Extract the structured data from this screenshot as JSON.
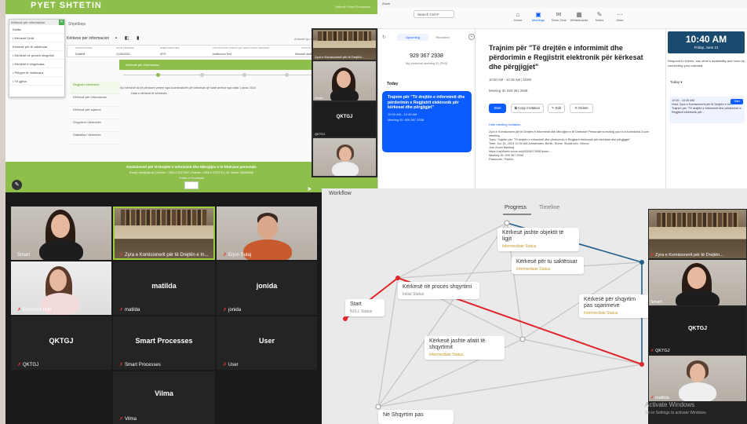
{
  "web_app": {
    "title": "PYET SHTETIN",
    "top_right": "Ndihmë   Smart Processes",
    "menu_header": "Kërkesë për informacion",
    "menu_items": [
      "Drafte",
      "• Kërkesë Draft",
      "Kërkesë për të caktimuar",
      "• Kërkesë në proces shqyrtimi",
      "• Kërkesë e shqyrtuara",
      "• Pëlqyer të rishikuara",
      "• Të gjitha"
    ],
    "sub_header": "Shpëlbeje",
    "request_title": "Kërkese per informacion",
    "request_tools": "▪ ◧ ▮",
    "request_link": "Ankesë kjo më pë afatet",
    "table_headers": [
      "KANDIDATURË",
      "DATË KËRKESE",
      "EMËR KËRKUESI",
      "INSTITUCIONI PUBLIK QË I DREJTOHET KËRKESA",
      "STATUSI"
    ],
    "table_row": [
      "Draft/off",
      "21/06/2024",
      "SPO",
      "Institucioni Test",
      "Kërkesë draft"
    ],
    "green_bar": "Kërkesë për informacion",
    "side_menu": [
      "Regjistro kërkesën",
      "Kërkesë për informacion",
      "Kërkesë për sqarimi",
      "Shqyrtimi i kërkesës",
      "Statistika / kërkesës"
    ],
    "note_line1": "Kjo kërkesë do të përdoret vetëm nga koordinatorët për kërkesat që kanë ardhur nga data 1 janar 2024",
    "note_line2": "Data e kërkimit të kërkesës",
    "footer_line1": "Komisioneri për të Drejtën e Informimit dhe Mbrojtjen e të Dhënave personale",
    "footer_line2": "Email: info@idp.al | Telefon: +355 4 2237200 | Telefax: +355 4 2237211 | Nr. Jeshil: 08000988",
    "footer_line3": "Politika e Privatësisë"
  },
  "mini_strip": {
    "tile1_label": "Zyra e Komisionerit për të Drejtën...",
    "tile2_label": "Smart",
    "tile3_center": "QKTGJ",
    "tile3_label": "QKTGJ",
    "tile4_label": ""
  },
  "zoom": {
    "window_title": "Zoom",
    "search_label": "Search  Ctrl+F",
    "nav": [
      {
        "icon": "⌂",
        "label": "Home"
      },
      {
        "icon": "▣",
        "label": "Meetings"
      },
      {
        "icon": "✉",
        "label": "Team Chat"
      },
      {
        "icon": "▦",
        "label": "Whiteboards"
      },
      {
        "icon": "✎",
        "label": "Notes"
      },
      {
        "icon": "⋯",
        "label": "More"
      }
    ],
    "tab_upcoming": "Upcoming",
    "tab_recorded": "Recorded",
    "pmi_number": "929 367 2938",
    "pmi_label": "My personal meeting ID (PMI)",
    "today_label": "Today",
    "card_title": "Trajnim për \"Të drejtën e informimit dhe përdorimin e Regjistrit elektronik për kërkesat dhe përgjigjet\"",
    "card_time": "10:00 AM - 10:45 AM",
    "card_id": "Meeting ID: 929 367 2938",
    "main_title": "Trajnim për \"Të drejtën e informimit dhe përdorimin e Regjistrit elektronik për kërkesat dhe përgjigjet\"",
    "main_time": "10:00 AM - 10:45 AM  |  NOW",
    "main_id": "Meeting ID: 929 367 2938",
    "btn_start": "Start",
    "btn_copy": "Copy invitation",
    "btn_edit": "Edit",
    "btn_delete": "Delete",
    "more_link": "Hide meeting invitation",
    "desc": "Zyra e Komisionerit për të Drejtën e Informimit dhe Mbrojtjen e të Dhënave Personale is inviting you to a scheduled Zoom meeting.\nTopic: Trajnim për \"Të drejtën e informimit dhe përdorimin e Regjistrit elektronik për kërkesat dhe përgjigjet\"\nTime: Jun 21, 2024 10:00 AM Amsterdam, Berlin, Rome, Stockholm, Vienna\nJoin Zoom Meeting\nhttps://us06web.zoom.us/j/9293672938?pwd=...\nMeeting ID: 929 367 2938\nPasscode: 7NdiZu",
    "clock_time": "10:40 AM",
    "clock_date": "Friday, June 21",
    "right_tip": "Respond to events, see other's availability and more by connecting your calendar",
    "right_today": "Today ▾",
    "right_card": "10:00 - 10:45 AM\nHost: Zyra e Komisionerit për të Drejtën e Inf...\nTrajnim për \"Të drejtën e informimit dhe përdorimin e Regjistrit elektronik për...",
    "right_start": "Start"
  },
  "gallery": {
    "tiles": [
      {
        "name": "Smart",
        "type": "video"
      },
      {
        "name": "Zyra e Komisionerit për të Drejtën e In...",
        "type": "video"
      },
      {
        "name": "Erjon Sulaj",
        "type": "video"
      },
      {
        "name": "Emirjona Huti",
        "type": "video"
      },
      {
        "name": "matilda",
        "big": "matilda",
        "type": "name"
      },
      {
        "name": "jonida",
        "big": "jonida",
        "type": "name"
      },
      {
        "name": "QKTGJ",
        "big": "QKTGJ",
        "type": "name"
      },
      {
        "name": "Smart Processes",
        "big": "Smart Processes",
        "type": "name"
      },
      {
        "name": "User",
        "big": "User",
        "type": "name"
      },
      {
        "name": "Vilma",
        "big": "Vilma",
        "type": "name"
      }
    ]
  },
  "workflow": {
    "title": "Workflow",
    "tab_progress": "Progress",
    "tab_timeline": "Timeline",
    "nodes": [
      {
        "title": "Start",
        "status": "NULL Status"
      },
      {
        "title": "Kërkesë në proces shqyrtimi",
        "status": "Initial Status"
      },
      {
        "title": "Kërkesë jashte objektit të ligjit",
        "status": "Intermediate Status"
      },
      {
        "title": "Kërkesë për tu saktësuar",
        "status": "Intermediate Status"
      },
      {
        "title": "Kërkesë për shqyrtim pas sqarimeve",
        "status": "Intermediate Status"
      },
      {
        "title": "Kërkesë jashte afatit të shqyrtimit",
        "status": "Intermediate Status"
      },
      {
        "title": "Ne Shqyrtim pas",
        "status": ""
      }
    ],
    "colors": {
      "active": "#e0262a",
      "blue": "#1f5f8b",
      "gray": "#c4c4c4"
    }
  },
  "strip": {
    "tile1_label": "Zyra e Komisionerit për të Drejtën...",
    "tile2_label": "Smart",
    "tile3_center": "QKTGJ",
    "tile3_label": "QKTGJ",
    "tile4_label": "matilda"
  },
  "windows_watermark": {
    "line1": "Activate Windows",
    "line2": "Go to Settings to activate Windows."
  }
}
